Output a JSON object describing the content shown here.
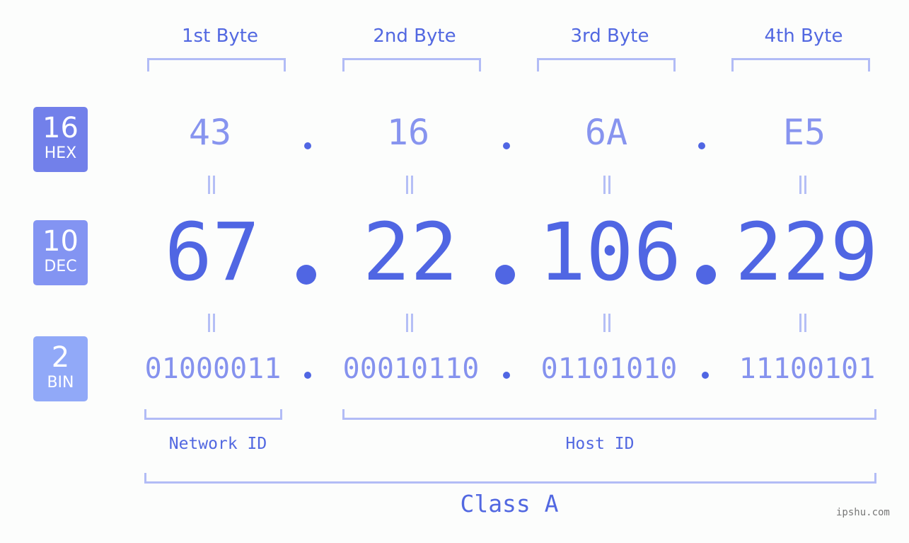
{
  "colors": {
    "hex_badge": "#7280ea",
    "dec_badge": "#8394f2",
    "bin_badge": "#91a9f8",
    "accent": "#5066e3",
    "bracket": "#b2bcf6"
  },
  "badges": [
    {
      "number": "16",
      "label": "HEX"
    },
    {
      "number": "10",
      "label": "DEC"
    },
    {
      "number": "2",
      "label": "BIN"
    }
  ],
  "byte_headers": [
    "1st Byte",
    "2nd Byte",
    "3rd Byte",
    "4th Byte"
  ],
  "hex": [
    "43",
    "16",
    "6A",
    "E5"
  ],
  "dec": [
    "67",
    "22",
    "106",
    "229"
  ],
  "bin": [
    "01000011",
    "00010110",
    "01101010",
    "11100101"
  ],
  "network_label": "Network ID",
  "host_label": "Host ID",
  "class_label": "Class A",
  "watermark": "ipshu.com"
}
